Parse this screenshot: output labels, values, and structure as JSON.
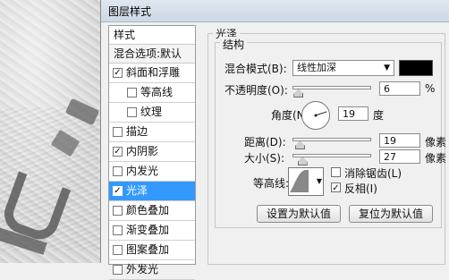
{
  "dialog": {
    "title": "图层样式"
  },
  "style_list": {
    "header": "样式",
    "blend_options": "混合选项:默认",
    "items": [
      {
        "label": "斜面和浮雕",
        "checked": true,
        "selected": false,
        "indent": 0
      },
      {
        "label": "等高线",
        "checked": false,
        "selected": false,
        "indent": 1
      },
      {
        "label": "纹理",
        "checked": false,
        "selected": false,
        "indent": 1
      },
      {
        "label": "描边",
        "checked": false,
        "selected": false,
        "indent": 0
      },
      {
        "label": "内阴影",
        "checked": true,
        "selected": false,
        "indent": 0
      },
      {
        "label": "内发光",
        "checked": false,
        "selected": false,
        "indent": 0
      },
      {
        "label": "光泽",
        "checked": true,
        "selected": true,
        "indent": 0
      },
      {
        "label": "颜色叠加",
        "checked": false,
        "selected": false,
        "indent": 0
      },
      {
        "label": "渐变叠加",
        "checked": false,
        "selected": false,
        "indent": 0
      },
      {
        "label": "图案叠加",
        "checked": false,
        "selected": false,
        "indent": 0
      },
      {
        "label": "外发光",
        "checked": false,
        "selected": false,
        "indent": 0
      }
    ]
  },
  "panel": {
    "group_title": "光泽",
    "section_title": "结构",
    "blend_mode": {
      "label": "混合模式(B):",
      "value": "线性加深",
      "color": "#000000"
    },
    "opacity": {
      "label": "不透明度(O):",
      "value": "6",
      "unit": "%",
      "level": 0.06
    },
    "angle": {
      "label": "角度(N):",
      "value": "19",
      "unit": "度"
    },
    "distance": {
      "label": "距离(D):",
      "value": "19",
      "unit": "像素",
      "level": 0.08
    },
    "size": {
      "label": "大小(S):",
      "value": "27",
      "unit": "像素",
      "level": 0.11
    },
    "contour": {
      "label": "等高线:"
    },
    "antialias": {
      "label": "消除锯齿(L)",
      "checked": false
    },
    "invert": {
      "label": "反相(I)",
      "checked": true
    },
    "buttons": {
      "set_default": "设置为默认值",
      "reset_default": "复位为默认值"
    }
  },
  "icons": {
    "dropdown": "chevron-down-icon",
    "check": "check-icon"
  }
}
